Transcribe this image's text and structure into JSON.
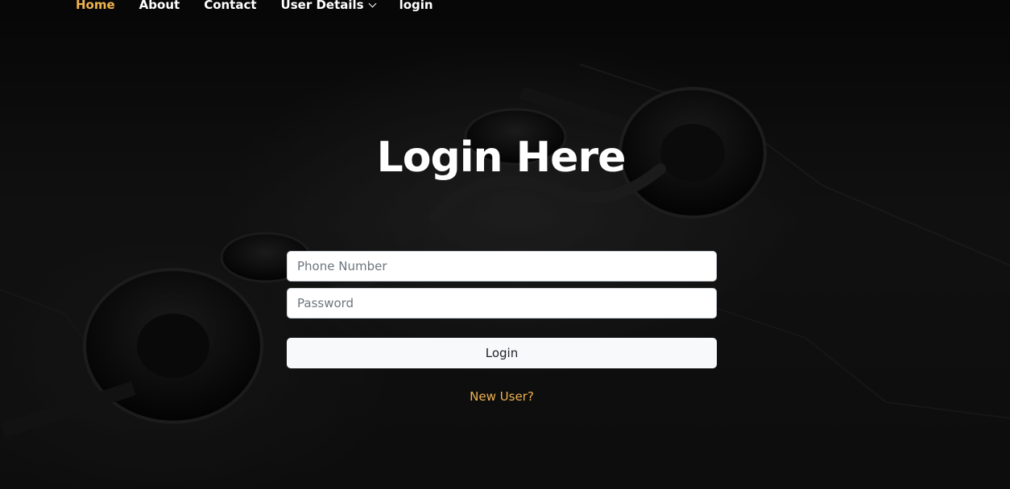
{
  "nav": {
    "items": [
      {
        "label": "Home",
        "active": true
      },
      {
        "label": "About"
      },
      {
        "label": "Contact"
      },
      {
        "label": "User Details",
        "has_dropdown": true
      },
      {
        "label": "login"
      }
    ]
  },
  "login": {
    "title": "Login Here",
    "phone_placeholder": "Phone Number",
    "password_placeholder": "Password",
    "button_label": "Login",
    "new_user_link": "New User?"
  },
  "colors": {
    "accent": "#f0b34e",
    "background": "#141414",
    "text": "#ffffff"
  }
}
